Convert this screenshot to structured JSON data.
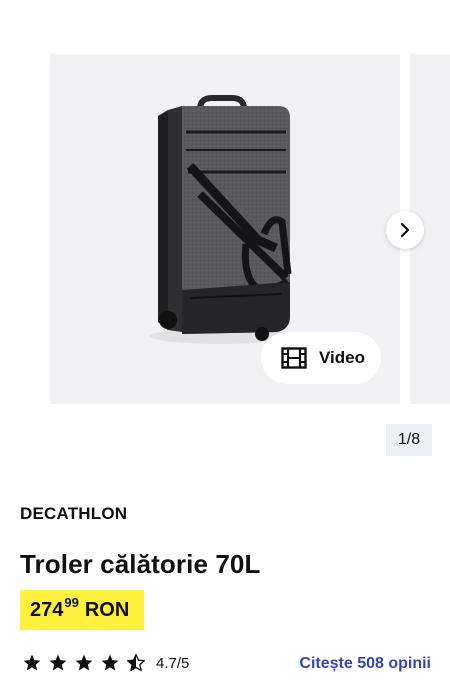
{
  "gallery": {
    "video_label": "Video",
    "pager": "1/8",
    "image_alt": "Troler călătorie 70L"
  },
  "product": {
    "brand": "DECATHLON",
    "title": "Troler călătorie 70L",
    "price_int": "274",
    "price_dec": "99",
    "currency": "RON",
    "rating": 4.7,
    "rating_text": "4.7/5",
    "reviews_link": "Citește 508 opinii"
  },
  "colors": {
    "price_bg": "#fff03d",
    "link": "#3643ba",
    "gallery_bg": "#f1f1f3"
  }
}
